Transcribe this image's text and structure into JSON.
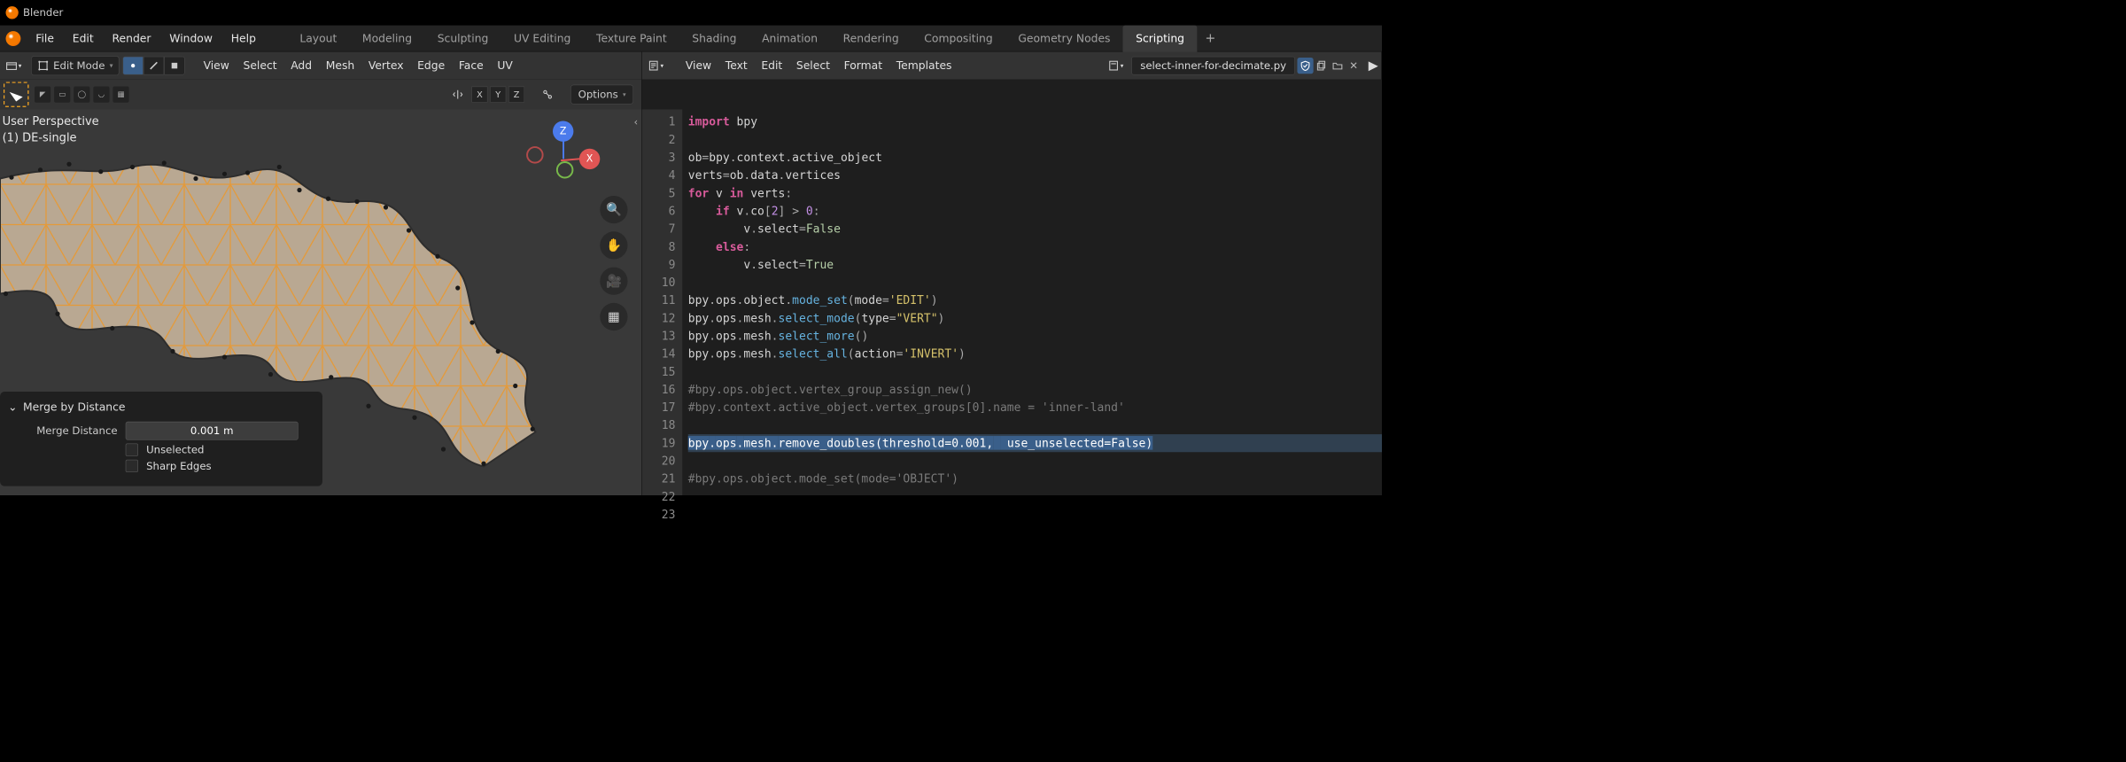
{
  "titlebar": {
    "app_name": "Blender"
  },
  "topmenu": [
    "File",
    "Edit",
    "Render",
    "Window",
    "Help"
  ],
  "workspaces": {
    "tabs": [
      "Layout",
      "Modeling",
      "Sculpting",
      "UV Editing",
      "Texture Paint",
      "Shading",
      "Animation",
      "Rendering",
      "Compositing",
      "Geometry Nodes",
      "Scripting"
    ],
    "active_index": 10,
    "add_label": "+"
  },
  "viewport_header": {
    "mode_label": "Edit Mode",
    "menus": [
      "View",
      "Select",
      "Add",
      "Mesh",
      "Vertex",
      "Edge",
      "Face",
      "UV"
    ]
  },
  "text_header": {
    "menus": [
      "View",
      "Text",
      "Edit",
      "Select",
      "Format",
      "Templates"
    ],
    "filename": "select-inner-for-decimate.py"
  },
  "tool_settings": {
    "axes": [
      "X",
      "Y",
      "Z"
    ],
    "options_label": "Options"
  },
  "viewport_overlay": {
    "line1": "User Perspective",
    "line2": "(1) DE-single"
  },
  "nav_axes": {
    "z": "Z",
    "x": "X"
  },
  "operator_panel": {
    "title": "Merge by Distance",
    "merge_distance_label": "Merge Distance",
    "merge_distance_value": "0.001 m",
    "unselected_label": "Unselected",
    "sharp_edges_label": "Sharp Edges"
  },
  "code": {
    "lines": [
      {
        "n": 1,
        "tokens": [
          [
            "kw",
            "import"
          ],
          [
            "txt",
            " bpy"
          ]
        ]
      },
      {
        "n": 2,
        "tokens": []
      },
      {
        "n": 3,
        "tokens": [
          [
            "txt",
            "ob"
          ],
          [
            "punct",
            "="
          ],
          [
            "txt",
            "bpy"
          ],
          [
            "punct",
            "."
          ],
          [
            "txt",
            "context"
          ],
          [
            "punct",
            "."
          ],
          [
            "txt",
            "active_object"
          ]
        ]
      },
      {
        "n": 4,
        "tokens": [
          [
            "txt",
            "verts"
          ],
          [
            "punct",
            "="
          ],
          [
            "txt",
            "ob"
          ],
          [
            "punct",
            "."
          ],
          [
            "txt",
            "data"
          ],
          [
            "punct",
            "."
          ],
          [
            "txt",
            "vertices"
          ]
        ]
      },
      {
        "n": 5,
        "tokens": [
          [
            "kw",
            "for"
          ],
          [
            "txt",
            " v "
          ],
          [
            "kw",
            "in"
          ],
          [
            "txt",
            " verts"
          ],
          [
            "punct",
            ":"
          ]
        ]
      },
      {
        "n": 6,
        "tokens": [
          [
            "txt",
            "    "
          ],
          [
            "kw",
            "if"
          ],
          [
            "txt",
            " v"
          ],
          [
            "punct",
            "."
          ],
          [
            "txt",
            "co"
          ],
          [
            "punct",
            "["
          ],
          [
            "num",
            "2"
          ],
          [
            "punct",
            "]"
          ],
          [
            "txt",
            " "
          ],
          [
            "punct",
            ">"
          ],
          [
            "txt",
            " "
          ],
          [
            "num",
            "0"
          ],
          [
            "punct",
            ":"
          ]
        ]
      },
      {
        "n": 7,
        "tokens": [
          [
            "txt",
            "        v"
          ],
          [
            "punct",
            "."
          ],
          [
            "txt",
            "select"
          ],
          [
            "punct",
            "="
          ],
          [
            "bool",
            "False"
          ]
        ]
      },
      {
        "n": 8,
        "tokens": [
          [
            "txt",
            "    "
          ],
          [
            "kw",
            "else"
          ],
          [
            "punct",
            ":"
          ]
        ]
      },
      {
        "n": 9,
        "tokens": [
          [
            "txt",
            "        v"
          ],
          [
            "punct",
            "."
          ],
          [
            "txt",
            "select"
          ],
          [
            "punct",
            "="
          ],
          [
            "bool",
            "True"
          ]
        ]
      },
      {
        "n": 10,
        "tokens": []
      },
      {
        "n": 11,
        "tokens": [
          [
            "txt",
            "bpy"
          ],
          [
            "punct",
            "."
          ],
          [
            "txt",
            "ops"
          ],
          [
            "punct",
            "."
          ],
          [
            "txt",
            "object"
          ],
          [
            "punct",
            "."
          ],
          [
            "func",
            "mode_set"
          ],
          [
            "punct",
            "("
          ],
          [
            "txt",
            "mode"
          ],
          [
            "punct",
            "="
          ],
          [
            "str",
            "'EDIT'"
          ],
          [
            "punct",
            ")"
          ]
        ]
      },
      {
        "n": 12,
        "tokens": [
          [
            "txt",
            "bpy"
          ],
          [
            "punct",
            "."
          ],
          [
            "txt",
            "ops"
          ],
          [
            "punct",
            "."
          ],
          [
            "txt",
            "mesh"
          ],
          [
            "punct",
            "."
          ],
          [
            "func",
            "select_mode"
          ],
          [
            "punct",
            "("
          ],
          [
            "txt",
            "type"
          ],
          [
            "punct",
            "="
          ],
          [
            "str",
            "\"VERT\""
          ],
          [
            "punct",
            ")"
          ]
        ]
      },
      {
        "n": 13,
        "tokens": [
          [
            "txt",
            "bpy"
          ],
          [
            "punct",
            "."
          ],
          [
            "txt",
            "ops"
          ],
          [
            "punct",
            "."
          ],
          [
            "txt",
            "mesh"
          ],
          [
            "punct",
            "."
          ],
          [
            "func",
            "select_more"
          ],
          [
            "punct",
            "("
          ],
          [
            "punct",
            ")"
          ]
        ]
      },
      {
        "n": 14,
        "tokens": [
          [
            "txt",
            "bpy"
          ],
          [
            "punct",
            "."
          ],
          [
            "txt",
            "ops"
          ],
          [
            "punct",
            "."
          ],
          [
            "txt",
            "mesh"
          ],
          [
            "punct",
            "."
          ],
          [
            "func",
            "select_all"
          ],
          [
            "punct",
            "("
          ],
          [
            "txt",
            "action"
          ],
          [
            "punct",
            "="
          ],
          [
            "str",
            "'INVERT'"
          ],
          [
            "punct",
            ")"
          ]
        ]
      },
      {
        "n": 15,
        "tokens": []
      },
      {
        "n": 16,
        "tokens": [
          [
            "comment",
            "#bpy.ops.object.vertex_group_assign_new()"
          ]
        ]
      },
      {
        "n": 17,
        "tokens": [
          [
            "comment",
            "#bpy.context.active_object.vertex_groups[0].name = 'inner-land'"
          ]
        ]
      },
      {
        "n": 18,
        "tokens": []
      },
      {
        "n": 19,
        "selected": true,
        "tokens": [
          [
            "txt",
            "bpy"
          ],
          [
            "punct",
            "."
          ],
          [
            "txt",
            "ops"
          ],
          [
            "punct",
            "."
          ],
          [
            "txt",
            "mesh"
          ],
          [
            "punct",
            "."
          ],
          [
            "func",
            "remove_doubles"
          ],
          [
            "punct",
            "("
          ],
          [
            "txt",
            "threshold"
          ],
          [
            "punct",
            "="
          ],
          [
            "num",
            "0.001"
          ],
          [
            "punct",
            ","
          ],
          [
            "txt",
            " "
          ],
          [
            "txt",
            " use_unselected"
          ],
          [
            "punct",
            "="
          ],
          [
            "bool",
            "False"
          ],
          [
            "punct",
            ")"
          ]
        ]
      },
      {
        "n": 20,
        "tokens": []
      },
      {
        "n": 21,
        "tokens": [
          [
            "comment",
            "#bpy.ops.object.mode_set(mode='OBJECT')"
          ]
        ]
      },
      {
        "n": 22,
        "tokens": []
      },
      {
        "n": 23,
        "tokens": []
      }
    ]
  }
}
